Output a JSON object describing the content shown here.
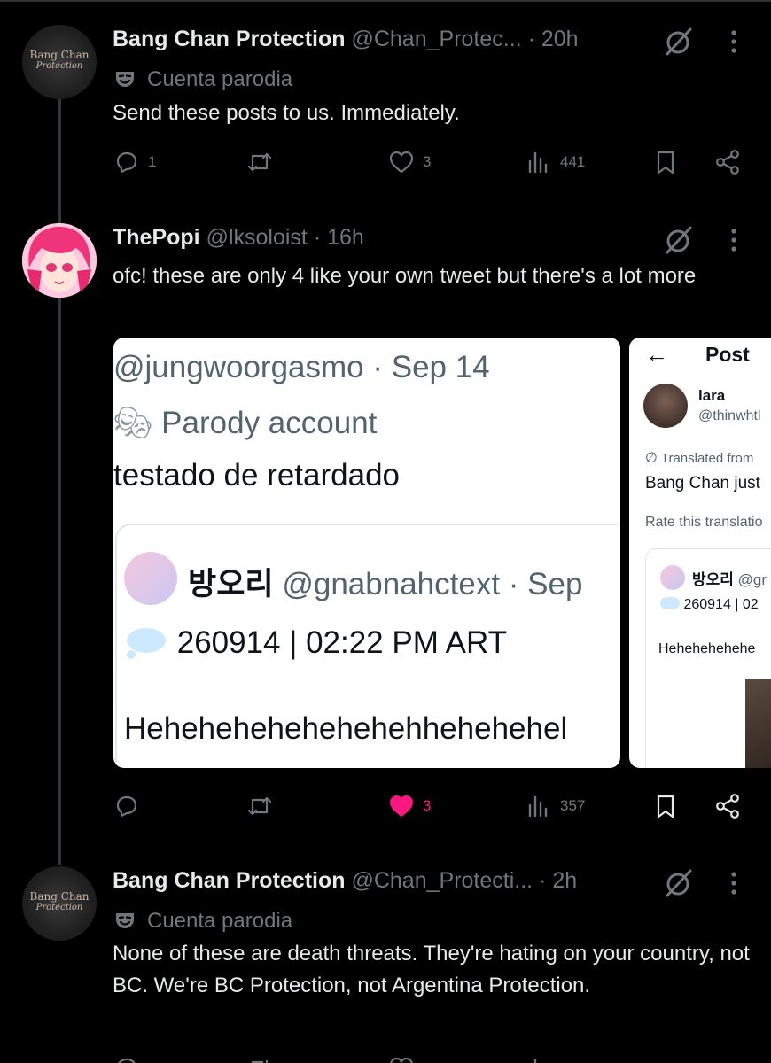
{
  "tweets": [
    {
      "name": "Bang Chan Protection",
      "handle": "@Chan_Protec...",
      "time": "· 20h",
      "parody_label": "Cuenta parodia",
      "text": "Send these posts to us. Immediately.",
      "replies": "1",
      "reposts": "",
      "likes": "3",
      "views": "441",
      "avatar_text_1": "Bang Chan",
      "avatar_text_2": "Protection"
    },
    {
      "name": "ThePopi",
      "handle": "@lksoloist",
      "time": "· 16h",
      "text": "ofc! these are only 4 like your own tweet but there's a lot more",
      "replies": "",
      "reposts": "",
      "likes": "3",
      "views": "357"
    },
    {
      "name": "Bang Chan Protection",
      "handle": "@Chan_Protecti...",
      "time": "· 2h",
      "parody_label": "Cuenta parodia",
      "text": "None of these are death threats. They're hating on your country, not BC. We're BC Protection, not Argentina Protection.",
      "avatar_text_1": "Bang Chan",
      "avatar_text_2": "Protection"
    }
  ],
  "image1": {
    "handle_date": "@jungwoorgasmo · Sep 14",
    "parody": "Parody account",
    "text": "testado de retardado",
    "quote_name": "방오리",
    "quote_handle": "@gnabnahctext · Sep",
    "quote_line": "260914 | 02:22 PM ART",
    "quote_text": "Hehehehehehehehehhehehehel"
  },
  "image2": {
    "back": "←",
    "title": "Post",
    "user": "lara",
    "handle": "@thinwhtl",
    "translated": "Translated from",
    "text": "Bang Chan just",
    "rate": "Rate this translatio",
    "quote_name": "방오리",
    "quote_handle": "@gr",
    "quote_line": "260914 | 02",
    "quote_text": "Hehehehehehe"
  },
  "colors": {
    "background": "#000000",
    "text": "#e7e9ea",
    "secondary": "#71767b",
    "like_active": "#f91880"
  }
}
